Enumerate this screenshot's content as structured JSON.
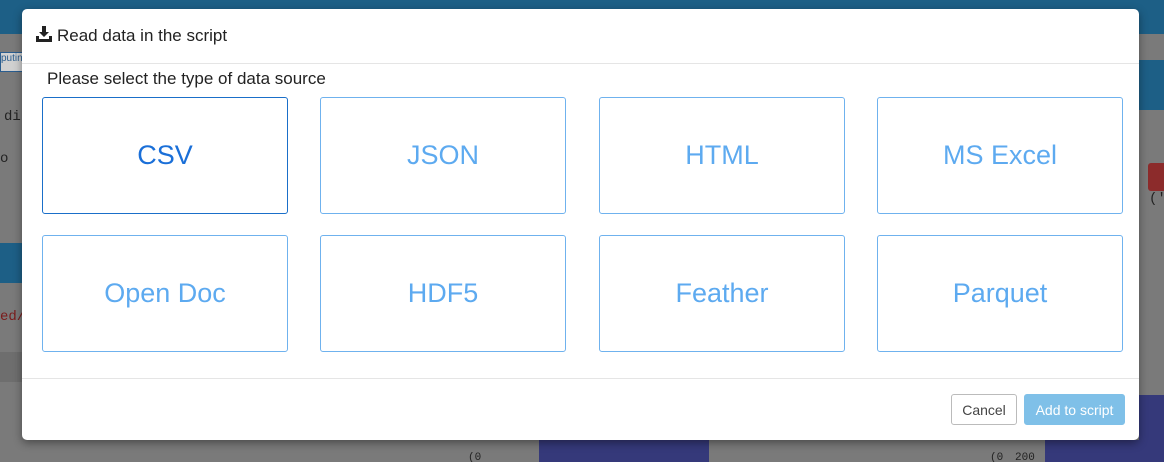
{
  "background": {
    "tab_label": "putin",
    "code_lines": [
      "di",
      "o"
    ],
    "path_fragment": "ed/",
    "paren_fragment": "('",
    "axis_fragments": [
      "(0",
      "(0",
      "200"
    ]
  },
  "modal": {
    "title": "Read data in the script",
    "prompt": "Please select the type of data source",
    "header_icon": "download-icon",
    "sources": [
      {
        "label": "CSV",
        "selected": true
      },
      {
        "label": "JSON",
        "selected": false
      },
      {
        "label": "HTML",
        "selected": false
      },
      {
        "label": "MS Excel",
        "selected": false
      },
      {
        "label": "Open Doc",
        "selected": false
      },
      {
        "label": "HDF5",
        "selected": false
      },
      {
        "label": "Feather",
        "selected": false
      },
      {
        "label": "Parquet",
        "selected": false
      }
    ],
    "footer": {
      "cancel_label": "Cancel",
      "add_label": "Add to script"
    }
  },
  "colors": {
    "tile_border": "#6fb2ee",
    "tile_text": "#5daaf0",
    "tile_selected": "#1a6fd8",
    "add_button": "#7fc0e8",
    "overlay": "#7a7a7a"
  }
}
